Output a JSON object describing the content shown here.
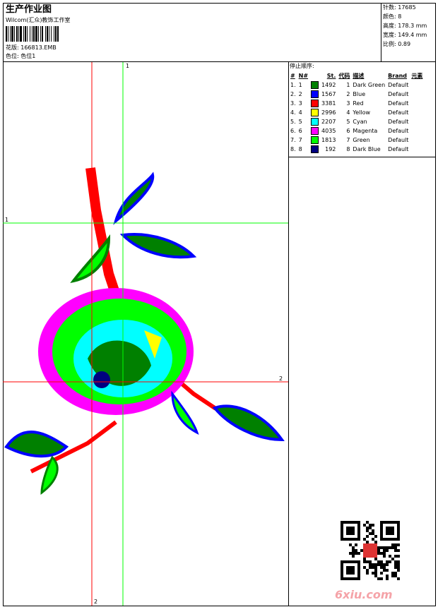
{
  "header": {
    "title": "生产作业图",
    "subtitle": "Wilcom(汇众)教饰工作室",
    "design_file_label": "花版:",
    "design_file": "166813.EMB",
    "colorway_label": "色位:",
    "colorway": "色位1"
  },
  "stats": [
    {
      "label": "针数:",
      "value": "17685"
    },
    {
      "label": "颜色:",
      "value": "8"
    },
    {
      "label": "高度:",
      "value": "178.3 mm"
    },
    {
      "label": "宽度:",
      "value": "149.4 mm"
    },
    {
      "label": "比例:",
      "value": "0.89"
    }
  ],
  "stop_sequence": {
    "title": "停止顺序:",
    "headers": [
      "#",
      "N#",
      "St.",
      "代码",
      "描述",
      "Brand",
      "元素"
    ],
    "rows": [
      {
        "idx": "1.",
        "n": "1",
        "color": "#008000",
        "stitches": "1492",
        "code": "1",
        "desc": "Dark Green",
        "brand": "Default"
      },
      {
        "idx": "2.",
        "n": "2",
        "color": "#0000ff",
        "stitches": "1567",
        "code": "2",
        "desc": "Blue",
        "brand": "Default"
      },
      {
        "idx": "3.",
        "n": "3",
        "color": "#ff0000",
        "stitches": "3381",
        "code": "3",
        "desc": "Red",
        "brand": "Default"
      },
      {
        "idx": "4.",
        "n": "4",
        "color": "#ffff00",
        "stitches": "2996",
        "code": "4",
        "desc": "Yellow",
        "brand": "Default"
      },
      {
        "idx": "5.",
        "n": "5",
        "color": "#00ffff",
        "stitches": "2207",
        "code": "5",
        "desc": "Cyan",
        "brand": "Default"
      },
      {
        "idx": "6.",
        "n": "6",
        "color": "#ff00ff",
        "stitches": "4035",
        "code": "6",
        "desc": "Magenta",
        "brand": "Default"
      },
      {
        "idx": "7.",
        "n": "7",
        "color": "#00ff00",
        "stitches": "1813",
        "code": "7",
        "desc": "Green",
        "brand": "Default"
      },
      {
        "idx": "8.",
        "n": "8",
        "color": "#000080",
        "stitches": "192",
        "code": "8",
        "desc": "Dark Blue",
        "brand": "Default"
      }
    ]
  },
  "guides": {
    "vertical_1": "1",
    "horizontal_1": "1",
    "vertical_2": "2",
    "horizontal_2": "2"
  },
  "watermark": "6xiu.com"
}
